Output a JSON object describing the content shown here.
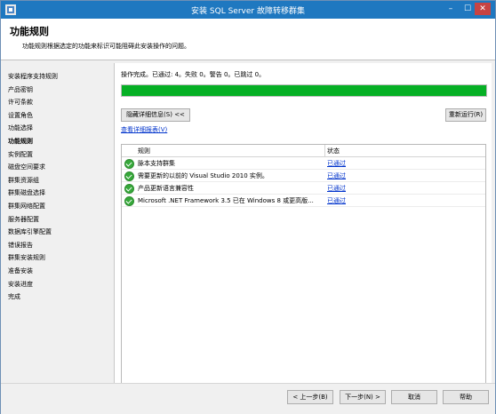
{
  "window": {
    "title": "安装 SQL Server 故障转移群集"
  },
  "header": {
    "title": "功能规则",
    "description": "功能规则根据选定的功能来标识可能阻碍此安装操作的问题。"
  },
  "sidebar": {
    "items": [
      {
        "label": "安装程序支持规则"
      },
      {
        "label": "产品密钥"
      },
      {
        "label": "许可条款"
      },
      {
        "label": "设置角色"
      },
      {
        "label": "功能选择"
      },
      {
        "label": "功能规则"
      },
      {
        "label": "实例配置"
      },
      {
        "label": "磁盘空间要求"
      },
      {
        "label": "群集资源组"
      },
      {
        "label": "群集磁盘选择"
      },
      {
        "label": "群集网络配置"
      },
      {
        "label": "服务器配置"
      },
      {
        "label": "数据库引擎配置"
      },
      {
        "label": "错误报告"
      },
      {
        "label": "群集安装规则"
      },
      {
        "label": "准备安装"
      },
      {
        "label": "安装进度"
      },
      {
        "label": "完成"
      }
    ]
  },
  "main": {
    "operation_summary": "操作完成。已通过: 4。失败 0。警告 0。已跳过 0。",
    "progress_fraction": 1.0,
    "hide_details_button": "隐藏详细信息(S) <<",
    "rerun_button": "重新运行(R)",
    "view_report_link": "查看详细报表(V)",
    "table": {
      "headers": {
        "rule": "规则",
        "status": "状态"
      },
      "rows": [
        {
          "rule": "脉本支持群集",
          "status": "已通过"
        },
        {
          "rule": "需要更新的以前的 Visual Studio 2010 实例。",
          "status": "已通过"
        },
        {
          "rule": "产品更新语言兼容性",
          "status": "已通过"
        },
        {
          "rule": "Microsoft .NET Framework 3.5 已在 Windows 8 或更高版...",
          "status": "已通过"
        }
      ]
    }
  },
  "footer": {
    "back_button": "< 上一步(B)",
    "next_button": "下一步(N) >",
    "cancel_button": "取消",
    "help_button": "帮助"
  },
  "colors": {
    "titlebar": "#1f78c0",
    "progress": "#06b025",
    "check": "#36a83a",
    "link": "#0033cc"
  },
  "icons": {
    "app": "sql-server-setup-icon",
    "passed": "green-check-icon"
  }
}
